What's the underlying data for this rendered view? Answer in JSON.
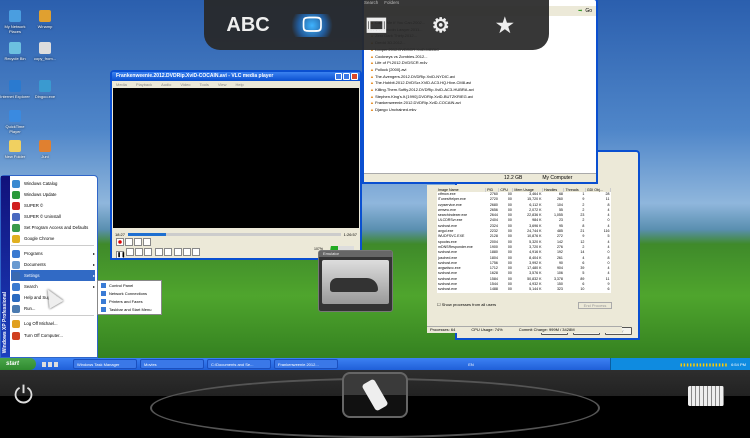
{
  "desktop": {
    "icons": [
      {
        "label": "My Network Places"
      },
      {
        "label": "Winamp"
      },
      {
        "label": "Recycle Bin"
      },
      {
        "label": "copy_from..."
      },
      {
        "label": "Internet Explorer"
      },
      {
        "label": "Dingoo.exe"
      },
      {
        "label": "QuickTime Player"
      },
      {
        "label": "New Folder"
      },
      {
        "label": "Juni"
      }
    ]
  },
  "overlay_top": {
    "items": [
      {
        "label": "ABC",
        "icon": "text-input-icon"
      },
      {
        "label": "",
        "icon": "monitor-icon",
        "selected": true
      },
      {
        "label": "",
        "icon": "film-icon"
      },
      {
        "label": "",
        "icon": "gears-icon"
      },
      {
        "label": "",
        "icon": "remote-star-icon"
      }
    ]
  },
  "explorer": {
    "toolbar": {
      "search": "Search",
      "folders": "Folders"
    },
    "go": "Go",
    "files": [
      "Catch Me If You Can.2002...",
      "The Lincoln Lawyer.2011...",
      "Zero Dark Thirty.2012...",
      "Dredd 3D.2012...",
      "Looper.2012.DVDSCR.XviD-MEDIC",
      "Cockneys vs Zombies.2012...",
      "Life of Pi.2012.DVDSCR.m4v",
      "Pollock [2000].avi",
      "The.Avengers.2012.DVDRip.XviD-NYDIC.avi",
      "The.Hobbit.2012.DVDScr.XViD.AC3.HQ.Hive-CM8.avi",
      "Killing.Them.Softly.2012.DVDRip.XviD-AC3-HUBRA.avi",
      "Stephen.King's.It.[1990].DVDRip.XviD-BUTZKRIEG.avi",
      "Frankenweenie.2012.DVDRip.XviD-COCAIN.avi",
      "Django Unchained.mkv"
    ],
    "status_size": "12.2 GB",
    "status_location": "My Computer"
  },
  "vlc": {
    "title": "Frankenweenie.2012.DVDRip.XviD-COCAIN.avi - VLC media player",
    "menu": [
      "Media",
      "Playback",
      "Audio",
      "Video",
      "Tools",
      "View",
      "Help"
    ],
    "elapsed": "18:27",
    "total": "1:26:57",
    "progress": 0.18,
    "volume": "107%"
  },
  "emulator": {
    "title": "Emulator"
  },
  "task_manager": {
    "columns": [
      "Image Name",
      "PID",
      "CPU",
      "Mem Usage",
      "Handles",
      "Threads",
      "GDI Obj..."
    ],
    "rows": [
      [
        "ctfmon.exe",
        "2760",
        "00",
        "3,464 K",
        "68",
        "1",
        "28"
      ],
      [
        "iTunesHelper.exe",
        "2720",
        "00",
        "15,720 K",
        "260",
        "9",
        "11"
      ],
      [
        "cvpservice.exe",
        "2680",
        "00",
        "6,112 K",
        "104",
        "2",
        "8"
      ],
      [
        "wmvnc.exe",
        "2656",
        "00",
        "2,072 K",
        "55",
        "2",
        "4"
      ],
      [
        "searchindexer.exe",
        "2644",
        "00",
        "22,836 K",
        "1,055",
        "23",
        "4"
      ],
      [
        "ULCDRSvr.exe",
        "2404",
        "00",
        "984 K",
        "23",
        "2",
        "0"
      ],
      [
        "svchost.exe",
        "2324",
        "00",
        "3,696 K",
        "95",
        "8",
        "4"
      ],
      [
        "avgui.exe",
        "2232",
        "00",
        "24,744 K",
        "485",
        "21",
        "116"
      ],
      [
        "WUDFSVC.EXE",
        "2128",
        "00",
        "10,876 K",
        "272",
        "9",
        "5"
      ],
      [
        "spoolsv.exe",
        "2004",
        "00",
        "5,320 K",
        "142",
        "12",
        "4"
      ],
      [
        "mDNSResponder.exe",
        "1900",
        "00",
        "3,720 K",
        "276",
        "2",
        "4"
      ],
      [
        "svchost.exe",
        "1880",
        "00",
        "4,916 K",
        "192",
        "14",
        "0"
      ],
      [
        "jusched.exe",
        "1804",
        "00",
        "8,404 K",
        "261",
        "4",
        "8"
      ],
      [
        "svchost.exe",
        "1756",
        "00",
        "3,992 K",
        "90",
        "6",
        "0"
      ],
      [
        "avgwdsvc.exe",
        "1712",
        "00",
        "17,480 K",
        "904",
        "39",
        "4"
      ],
      [
        "svchost.exe",
        "1628",
        "00",
        "3,576 K",
        "106",
        "5",
        "4"
      ],
      [
        "svchost.exe",
        "1584",
        "00",
        "50,832 K",
        "3,378",
        "89",
        "11"
      ],
      [
        "svchost.exe",
        "1544",
        "00",
        "4,932 K",
        "150",
        "6",
        "9"
      ],
      [
        "svchost.exe",
        "1488",
        "00",
        "5,144 K",
        "323",
        "10",
        "6"
      ]
    ],
    "show_all": "Show processes from all users",
    "end_process": "End Process",
    "processes": "Processes: 64",
    "cpu": "CPU Usage: 74%",
    "commit": "Commit Charge: 999M / 3428M"
  },
  "dialog": {
    "ok": "OK",
    "cancel": "Cancel",
    "apply": "Apply"
  },
  "start_menu": {
    "banner": "Windows XP Professional",
    "items": [
      "Windows Catalog",
      "Windows Update",
      "SUPER ©",
      "SUPER © Uninstall",
      "Set Program Access and Defaults",
      "Google Chrome",
      "Programs",
      "Documents",
      "Settings",
      "Search",
      "Help and Support",
      "Run...",
      "Log Off Michael...",
      "Turn Off Computer..."
    ],
    "settings_sub": [
      "Control Panel",
      "Network Connections",
      "Printers and Faxes",
      "Taskbar and Start Menu"
    ]
  },
  "taskbar": {
    "start": "start",
    "buttons": [
      "Windows Task Manager",
      "Movies",
      "C:\\Documents and Se...",
      "Frankenweenie.2012..."
    ],
    "lang": "EN",
    "clock": "6:54 PM"
  }
}
